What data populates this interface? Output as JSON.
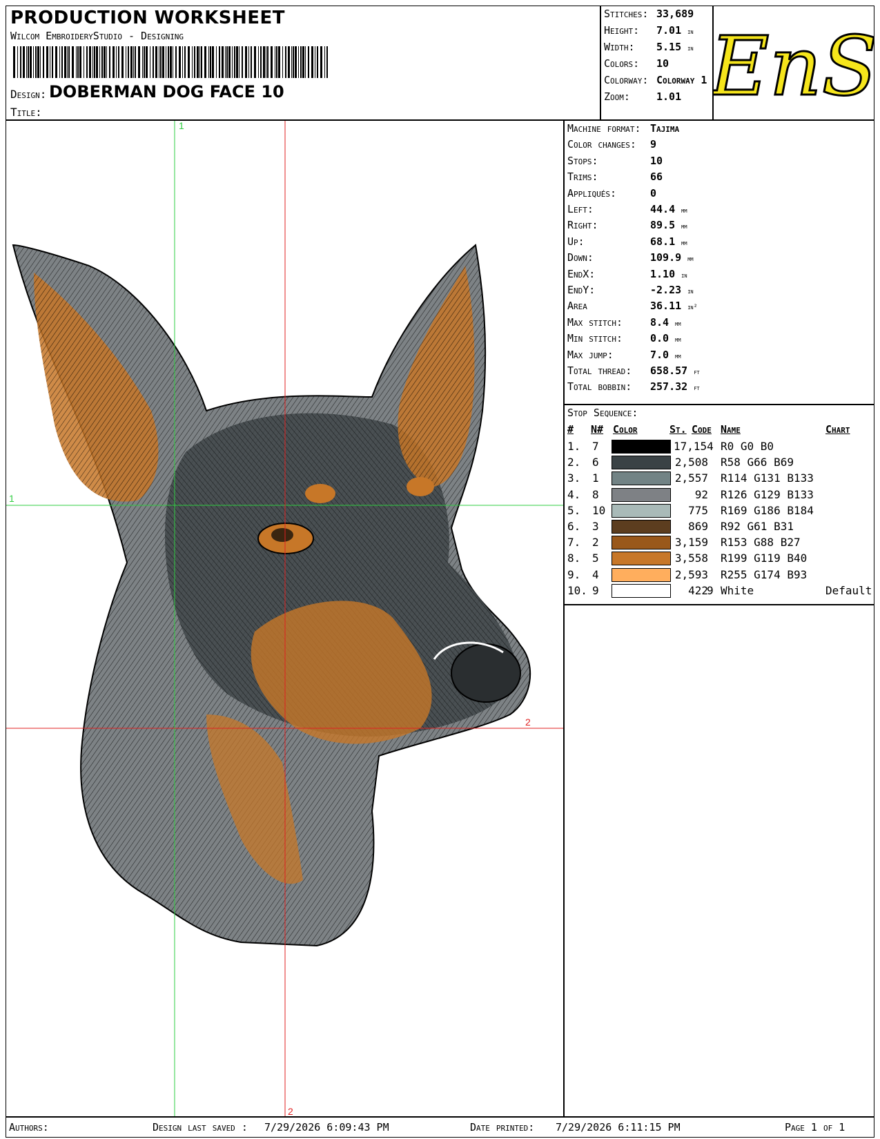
{
  "header": {
    "title": "PRODUCTION WORKSHEET",
    "subtitle": "Wilcom EmbroideryStudio - Designing",
    "design_label": "Design:",
    "design_name": "DOBERMAN DOG FACE  10",
    "title_label": "Title:"
  },
  "summary": [
    {
      "label": "Stitches:",
      "value": "33,689",
      "unit": ""
    },
    {
      "label": "Height:",
      "value": "7.01",
      "unit": "in"
    },
    {
      "label": "Width:",
      "value": "5.15",
      "unit": "in"
    },
    {
      "label": "Colors:",
      "value": "10",
      "unit": ""
    },
    {
      "label": "Colorway:",
      "value": "Colorway 1",
      "unit": ""
    },
    {
      "label": "Zoom:",
      "value": "1.01",
      "unit": ""
    }
  ],
  "logo": {
    "text": "EnS",
    "color": "#F5E51B"
  },
  "stats": [
    {
      "label": "Machine format:",
      "value": "Tajima",
      "unit": ""
    },
    {
      "label": "Color changes:",
      "value": "9",
      "unit": ""
    },
    {
      "label": "Stops:",
      "value": "10",
      "unit": ""
    },
    {
      "label": "Trims:",
      "value": "66",
      "unit": ""
    },
    {
      "label": "Appliqués:",
      "value": "0",
      "unit": ""
    },
    {
      "label": "Left:",
      "value": "44.4",
      "unit": "mm"
    },
    {
      "label": "Right:",
      "value": "89.5",
      "unit": "mm"
    },
    {
      "label": "Up:",
      "value": "68.1",
      "unit": "mm"
    },
    {
      "label": "Down:",
      "value": "109.9",
      "unit": "mm"
    },
    {
      "label": "EndX:",
      "value": "1.10",
      "unit": "in"
    },
    {
      "label": "EndY:",
      "value": "-2.23",
      "unit": "in"
    },
    {
      "label": "Area",
      "value": "36.11",
      "unit": "in²"
    },
    {
      "label": "Max stitch:",
      "value": "8.4",
      "unit": "mm"
    },
    {
      "label": "Min stitch:",
      "value": "0.0",
      "unit": "mm"
    },
    {
      "label": "Max jump:",
      "value": "7.0",
      "unit": "mm"
    },
    {
      "label": "Total thread:",
      "value": "658.57",
      "unit": "ft"
    },
    {
      "label": "Total bobbin:",
      "value": "257.32",
      "unit": "ft"
    }
  ],
  "stop_sequence": {
    "title": "Stop Sequence:",
    "headers": [
      "#",
      "N#",
      "Color",
      "St.",
      "Code",
      "Name",
      "Chart"
    ],
    "rows": [
      {
        "n": "1.",
        "needle": "7",
        "color": "#000000",
        "stitches": "17,154",
        "code": "",
        "name": "R0 G0 B0",
        "chart": ""
      },
      {
        "n": "2.",
        "needle": "6",
        "color": "#3A4245",
        "stitches": "2,508",
        "code": "",
        "name": "R58 G66 B69",
        "chart": ""
      },
      {
        "n": "3.",
        "needle": "1",
        "color": "#728385",
        "stitches": "2,557",
        "code": "",
        "name": "R114 G131 B133",
        "chart": ""
      },
      {
        "n": "4.",
        "needle": "8",
        "color": "#7E8185",
        "stitches": "92",
        "code": "",
        "name": "R126 G129 B133",
        "chart": ""
      },
      {
        "n": "5.",
        "needle": "10",
        "color": "#A9BAB8",
        "stitches": "775",
        "code": "",
        "name": "R169 G186 B184",
        "chart": ""
      },
      {
        "n": "6.",
        "needle": "3",
        "color": "#5C3D1F",
        "stitches": "869",
        "code": "",
        "name": "R92 G61 B31",
        "chart": ""
      },
      {
        "n": "7.",
        "needle": "2",
        "color": "#99581B",
        "stitches": "3,159",
        "code": "",
        "name": "R153 G88 B27",
        "chart": ""
      },
      {
        "n": "8.",
        "needle": "5",
        "color": "#C77728",
        "stitches": "3,558",
        "code": "",
        "name": "R199 G119 B40",
        "chart": ""
      },
      {
        "n": "9.",
        "needle": "4",
        "color": "#FFAE5D",
        "stitches": "2,593",
        "code": "",
        "name": "R255 G174 B93",
        "chart": ""
      },
      {
        "n": "10.",
        "needle": "9",
        "color": "#FFFFFF",
        "stitches": "422",
        "code": "9",
        "name": "White",
        "chart": "Default"
      }
    ]
  },
  "drawing": {
    "axis_labels": {
      "v1": "1",
      "h1": "1",
      "h2": "2",
      "v2": "2"
    },
    "colors": {
      "green": "#2ECC40",
      "red": "#E02020"
    }
  },
  "footer": {
    "authors_label": "Authors:",
    "saved_label": "Design last saved :",
    "saved_value": "7/29/2026 6:09:43 PM",
    "printed_label": "Date printed:",
    "printed_value": "7/29/2026 6:11:15 PM",
    "page": "Page 1 of 1"
  }
}
